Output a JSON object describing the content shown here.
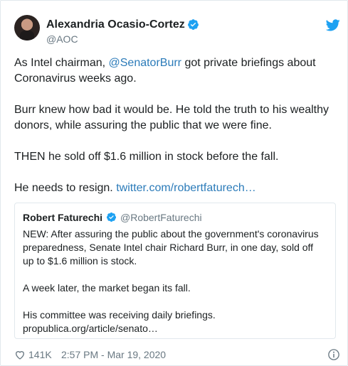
{
  "author": {
    "name": "Alexandria Ocasio-Cortez",
    "handle": "@AOC"
  },
  "tweet": {
    "p1_before": "As Intel chairman, ",
    "p1_mention": "@SenatorBurr",
    "p1_after": " got private briefings about Coronavirus weeks ago.",
    "p2": "Burr knew how bad it would be. He told the truth to his wealthy donors, while assuring the public that we were fine.",
    "p3": "THEN he sold off $1.6 million in stock before the fall.",
    "p4_before": "He needs to resign. ",
    "p4_link": "twitter.com/robertfaturech…"
  },
  "quote": {
    "name": "Robert Faturechi",
    "handle": "@RobertFaturechi",
    "p1": "NEW: After assuring the public about the government's coronavirus preparedness, Senate Intel chair Richard Burr, in one day, sold off up to $1.6 million is stock.",
    "p2": "A week later, the market began its fall.",
    "p3": "His committee was receiving daily briefings.",
    "p3_link": "propublica.org/article/senato…"
  },
  "footer": {
    "likes": "141K",
    "timestamp": "2:57 PM - Mar 19, 2020"
  },
  "colors": {
    "link": "#2b7bb9",
    "verified": "#1da1f2",
    "muted": "#697882"
  },
  "icons": [
    "verified-badge-icon",
    "twitter-bird-icon",
    "heart-icon",
    "info-icon"
  ]
}
